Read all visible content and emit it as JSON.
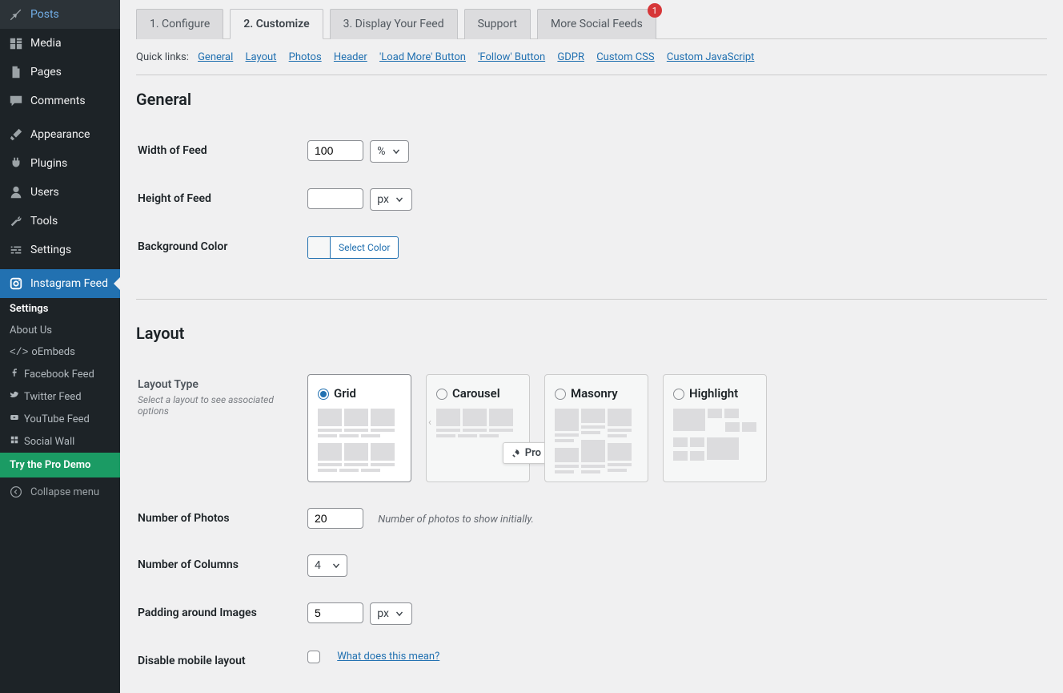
{
  "sidebar": {
    "items": [
      {
        "label": "Posts"
      },
      {
        "label": "Media"
      },
      {
        "label": "Pages"
      },
      {
        "label": "Comments"
      },
      {
        "label": "Appearance"
      },
      {
        "label": "Plugins"
      },
      {
        "label": "Users"
      },
      {
        "label": "Tools"
      },
      {
        "label": "Settings"
      },
      {
        "label": "Instagram Feed"
      }
    ],
    "submenu": [
      {
        "label": "Settings"
      },
      {
        "label": "About Us"
      },
      {
        "label": "oEmbeds"
      },
      {
        "label": "Facebook Feed"
      },
      {
        "label": "Twitter Feed"
      },
      {
        "label": "YouTube Feed"
      },
      {
        "label": "Social Wall"
      }
    ],
    "try_pro": "Try the Pro Demo",
    "collapse": "Collapse menu"
  },
  "tabs": [
    {
      "label": "1. Configure"
    },
    {
      "label": "2. Customize"
    },
    {
      "label": "3. Display Your Feed"
    },
    {
      "label": "Support"
    },
    {
      "label": "More Social Feeds",
      "badge": "1"
    }
  ],
  "quick_links": {
    "label": "Quick links:",
    "links": [
      "General",
      "Layout",
      "Photos",
      "Header",
      "'Load More' Button",
      "'Follow' Button",
      "GDPR",
      "Custom CSS",
      "Custom JavaScript"
    ]
  },
  "sections": {
    "general": {
      "title": "General",
      "width_label": "Width of Feed",
      "width_value": "100",
      "width_unit": "%",
      "height_label": "Height of Feed",
      "height_value": "",
      "height_unit": "px",
      "bg_label": "Background Color",
      "color_btn": "Select Color"
    },
    "layout": {
      "title": "Layout",
      "type_label": "Layout Type",
      "type_sub": "Select a layout to see associated options",
      "options": {
        "grid": "Grid",
        "carousel": "Carousel",
        "masonry": "Masonry",
        "highlight": "Highlight"
      },
      "pro_tag": "Pro",
      "num_photos_label": "Number of Photos",
      "num_photos_value": "20",
      "num_photos_desc": "Number of photos to show initially.",
      "num_cols_label": "Number of Columns",
      "num_cols_value": "4",
      "padding_label": "Padding around Images",
      "padding_value": "5",
      "padding_unit": "px",
      "disable_mobile_label": "Disable mobile layout",
      "disable_mobile_help": "What does this mean?"
    }
  }
}
